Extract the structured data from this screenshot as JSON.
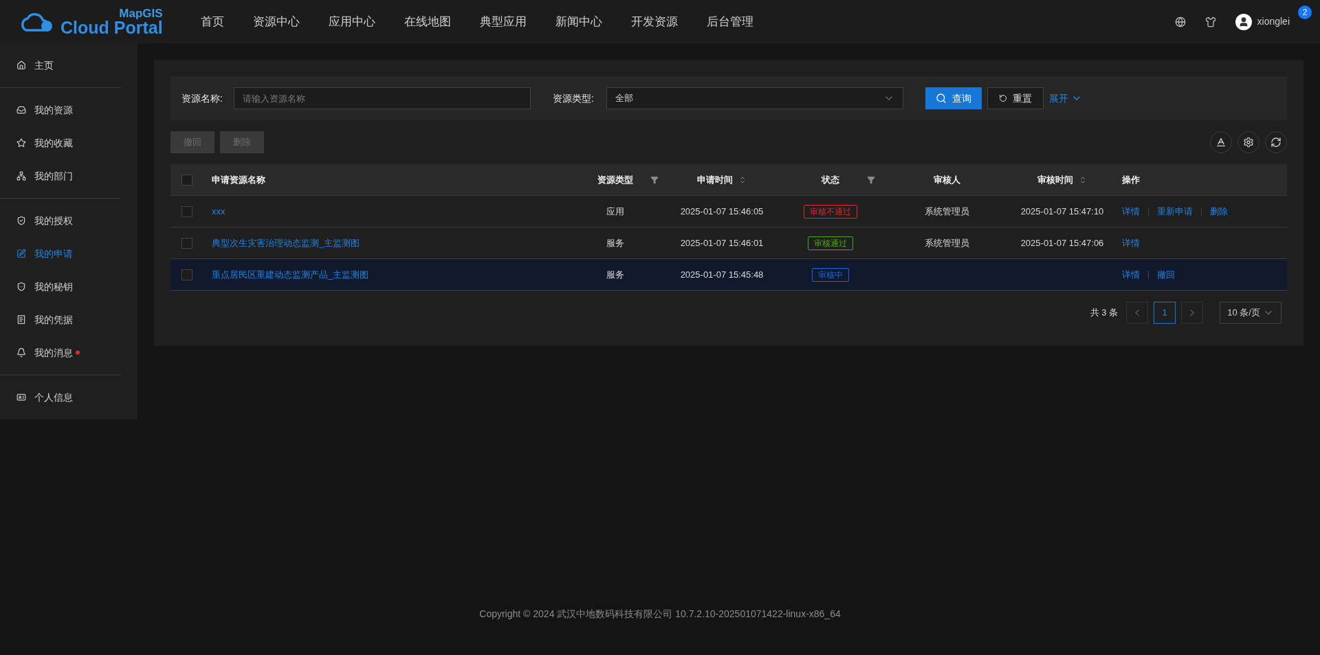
{
  "header": {
    "logo_top": "MapGIS",
    "logo_bottom": "Cloud Portal",
    "nav": [
      "首页",
      "资源中心",
      "应用中心",
      "在线地图",
      "典型应用",
      "新闻中心",
      "开发资源",
      "后台管理"
    ],
    "user": "xionglei",
    "notification_count": "2"
  },
  "sidebar": {
    "groups": [
      [
        {
          "label": "主页",
          "selected": false,
          "dot": false
        }
      ],
      [
        {
          "label": "我的资源",
          "selected": false,
          "dot": false
        },
        {
          "label": "我的收藏",
          "selected": false,
          "dot": false
        },
        {
          "label": "我的部门",
          "selected": false,
          "dot": false
        }
      ],
      [
        {
          "label": "我的授权",
          "selected": false,
          "dot": false
        },
        {
          "label": "我的申请",
          "selected": true,
          "dot": false
        },
        {
          "label": "我的秘钥",
          "selected": false,
          "dot": false
        },
        {
          "label": "我的凭据",
          "selected": false,
          "dot": false
        },
        {
          "label": "我的消息",
          "selected": false,
          "dot": true
        }
      ],
      [
        {
          "label": "个人信息",
          "selected": false,
          "dot": false
        }
      ]
    ]
  },
  "filters": {
    "name_label": "资源名称:",
    "name_placeholder": "请输入资源名称",
    "type_label": "资源类型:",
    "type_value": "全部",
    "query": "查询",
    "reset": "重置",
    "expand": "展开"
  },
  "toolbar": [
    {
      "label": "撤回",
      "disabled": true
    },
    {
      "label": "删除",
      "disabled": true
    }
  ],
  "table": {
    "all_checked": false,
    "columns": [
      {
        "label": "申请资源名称",
        "kind": "plain"
      },
      {
        "label": "资源类型",
        "kind": "filter"
      },
      {
        "label": "申请时间",
        "kind": "sort"
      },
      {
        "label": "状态",
        "kind": "filter"
      },
      {
        "label": "审核人",
        "kind": "plain"
      },
      {
        "label": "审核时间",
        "kind": "sort"
      },
      {
        "label": "操作",
        "kind": "plain"
      }
    ],
    "rows": [
      {
        "checked": false,
        "highlighted": false,
        "name": "xxx",
        "type": "应用",
        "applied": "2025-01-07 15:46:05",
        "status": {
          "text": "审核不通过",
          "color": "#e0282e"
        },
        "reviewer": "系统管理员",
        "reviewed": "2025-01-07 15:47:10",
        "actions": [
          "详情",
          "重新申请",
          "删除"
        ]
      },
      {
        "checked": false,
        "highlighted": false,
        "name": "典型次生灾害治理动态监测_主监测图",
        "type": "服务",
        "applied": "2025-01-07 15:46:01",
        "status": {
          "text": "审核通过",
          "color": "#49aa19"
        },
        "reviewer": "系统管理员",
        "reviewed": "2025-01-07 15:47:06",
        "actions": [
          "详情"
        ]
      },
      {
        "checked": false,
        "highlighted": true,
        "name": "重点居民区重建动态监测产品_主监测图",
        "type": "服务",
        "applied": "2025-01-07 15:45:48",
        "status": {
          "text": "审核中",
          "color": "#1668dc"
        },
        "actions": [
          "详情",
          "撤回"
        ]
      }
    ]
  },
  "pagination": {
    "total": "共 3 条",
    "pages": [
      {
        "label": "1",
        "selected": true
      }
    ],
    "page_size": "10 条/页"
  },
  "footer": "Copyright © 2024 武汉中地数码科技有限公司 10.7.2.10-202501071422-linux-x86_64"
}
